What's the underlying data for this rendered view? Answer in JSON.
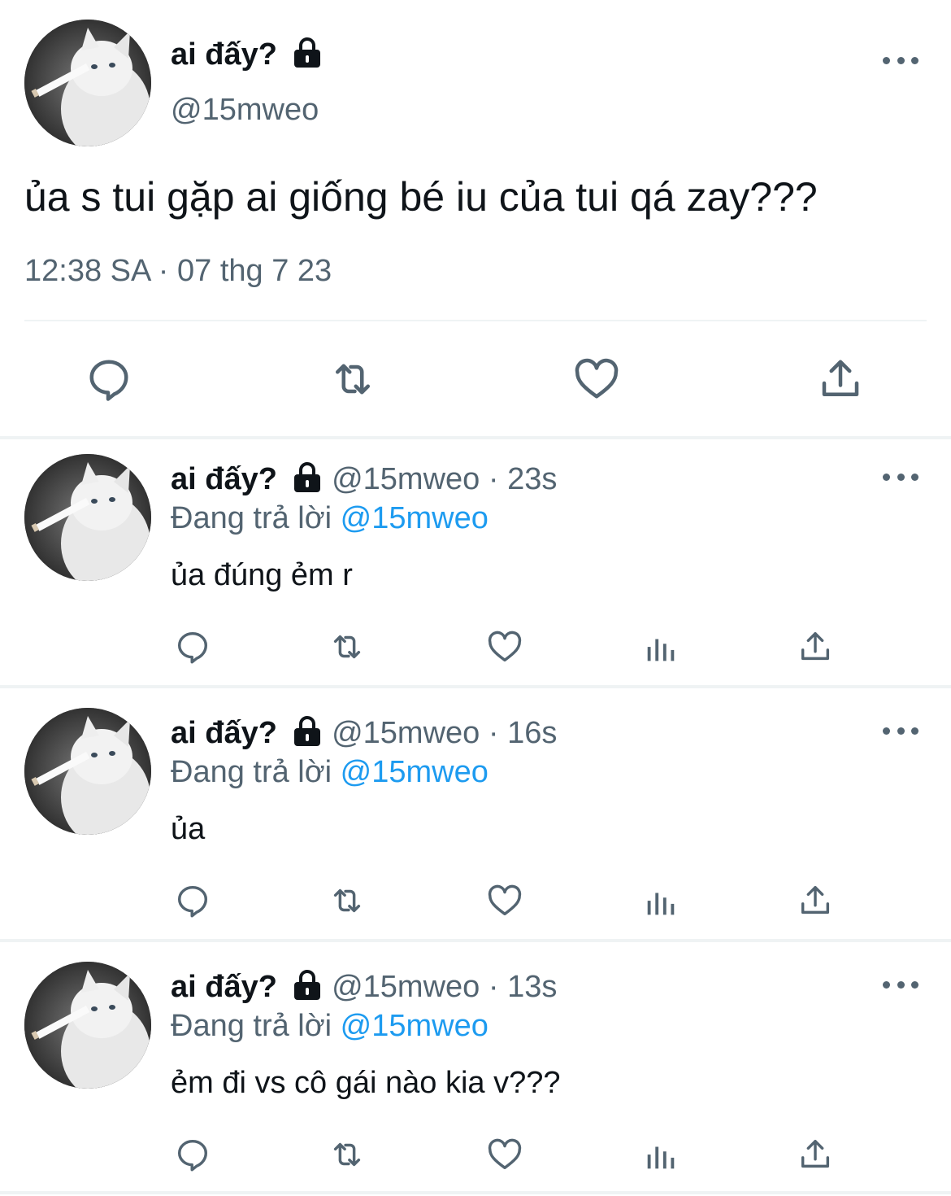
{
  "main_tweet": {
    "display_name": "ai đấy?",
    "handle": "@15mweo",
    "text": "ủa s tui gặp ai giống bé iu của tui qá zay???",
    "timestamp": "12:38 SA · 07 thg 7 23",
    "actions": [
      "reply-icon",
      "retweet-icon",
      "like-icon",
      "share-icon"
    ]
  },
  "replies": [
    {
      "display_name": "ai đấy?",
      "handle": "@15mweo",
      "time": "23s",
      "replying_label": "Đang trả lời",
      "replying_to": "@15mweo",
      "text": "ủa đúng ẻm r"
    },
    {
      "display_name": "ai đấy?",
      "handle": "@15mweo",
      "time": "16s",
      "replying_label": "Đang trả lời",
      "replying_to": "@15mweo",
      "text": "ủa"
    },
    {
      "display_name": "ai đấy?",
      "handle": "@15mweo",
      "time": "13s",
      "replying_label": "Đang trả lời",
      "replying_to": "@15mweo",
      "text": "ẻm đi vs cô gái nào kia v???"
    }
  ],
  "separator": " · ",
  "reply_actions": [
    "reply-icon",
    "retweet-icon",
    "like-icon",
    "analytics-icon",
    "share-icon"
  ],
  "colors": {
    "text": "#0f1419",
    "secondary": "#536471",
    "link": "#1d9bf0",
    "divider": "#eff3f4"
  }
}
